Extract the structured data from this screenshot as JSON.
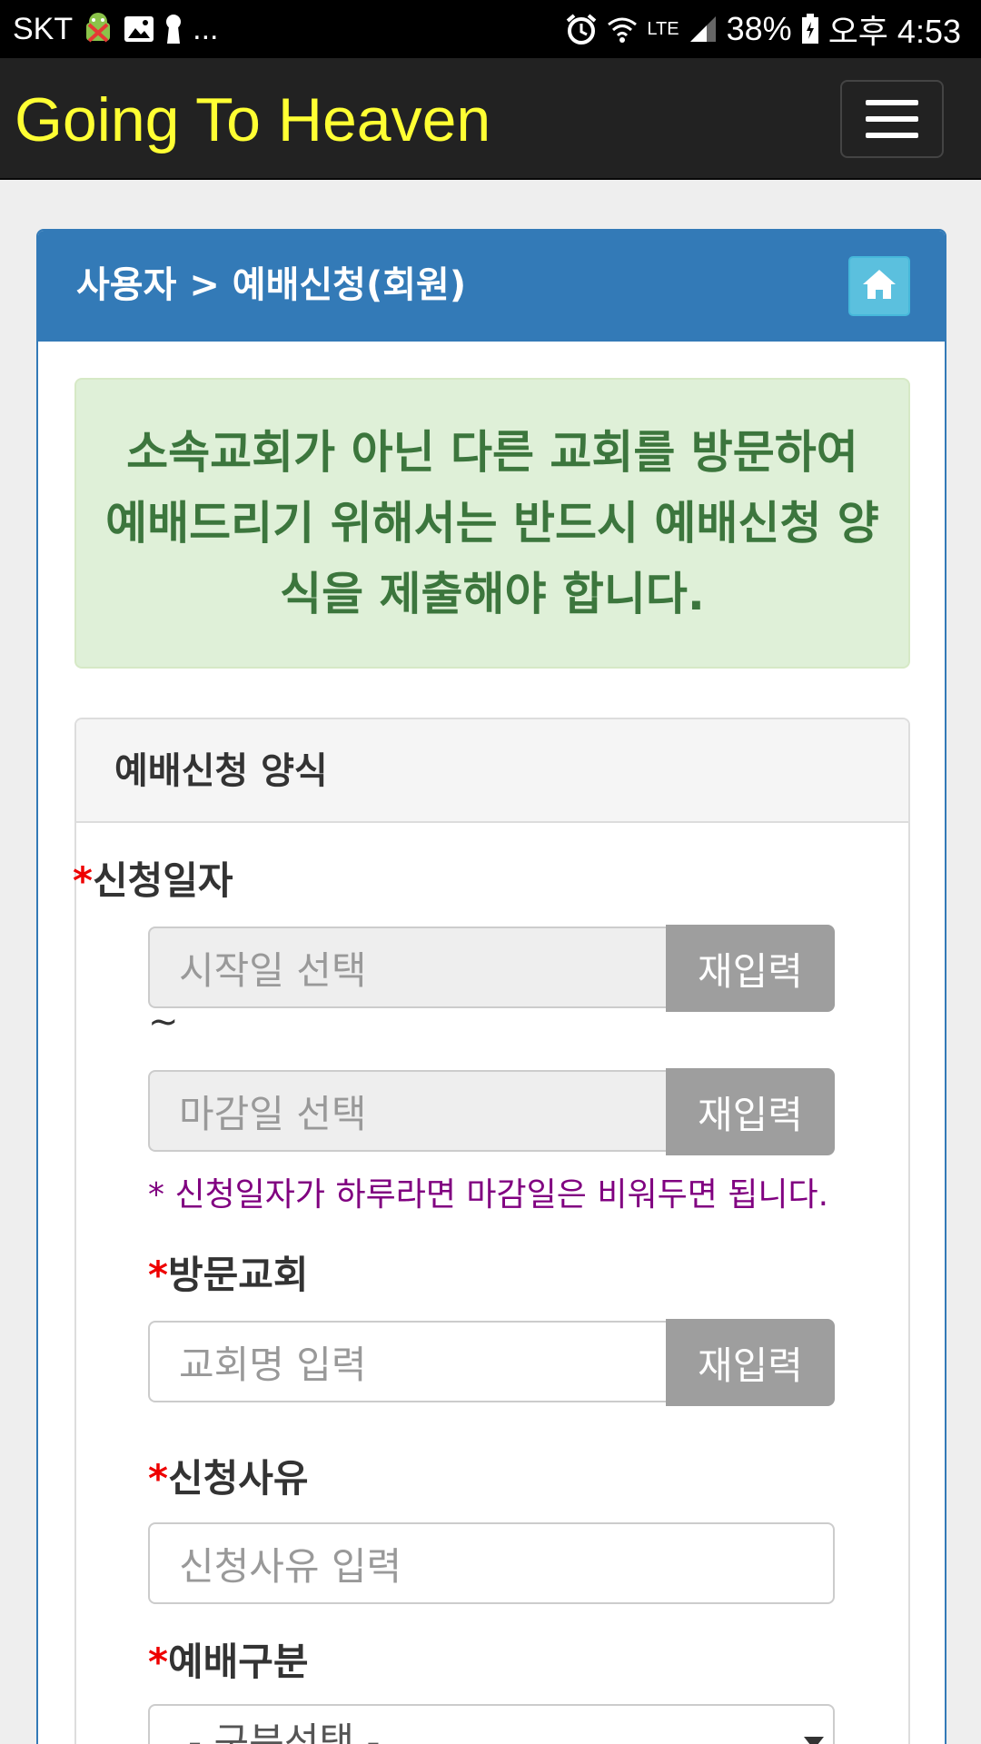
{
  "status_bar": {
    "carrier": "SKT",
    "more": "...",
    "network": "LTE",
    "battery": "38%",
    "time": "오후 4:53"
  },
  "navbar": {
    "brand": "Going To Heaven",
    "brand_color": "#ffff33"
  },
  "panel": {
    "breadcrumb": "사용자 > 예배신청(회원)",
    "alert": "소속교회가 아닌 다른 교회를 방문하여 예배드리기 위해서는 반드시 예배신청 양식을 제출해야 합니다.",
    "form_title": "예배신청 양식"
  },
  "form": {
    "required_mark": "*",
    "date": {
      "label": "신청일자",
      "start_placeholder": "시작일 선택",
      "end_placeholder": "마감일 선택",
      "reset_label": "재입력",
      "separator": "~",
      "note": "* 신청일자가 하루라면 마감일은 비워두면 됩니다."
    },
    "church": {
      "label": "방문교회",
      "placeholder": "교회명 입력",
      "reset_label": "재입력"
    },
    "reason": {
      "label": "신청사유",
      "placeholder": "신청사유 입력"
    },
    "worship_type": {
      "label": "예배구분",
      "selected": "- 구분선택 -"
    }
  }
}
